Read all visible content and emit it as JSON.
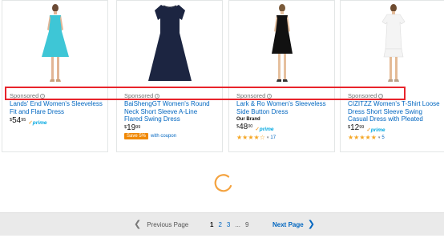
{
  "products": [
    {
      "sponsored_label": "Sponsored",
      "title_line1": "Lands' End Women's Sleeveless",
      "title_line2": "Fit and Flare Dress",
      "title_line3": "",
      "brand": "",
      "price_currency": "$",
      "price_whole": "54",
      "price_cents": "95",
      "prime_label": "prime",
      "coupon_badge": "",
      "coupon_text": "",
      "rating_stars": "",
      "rating_count": "",
      "dress_color": "#3ec6d6"
    },
    {
      "sponsored_label": "Sponsored",
      "title_line1": "BaiShengGT Women's Round",
      "title_line2": "Neck Short Sleeve A-Line",
      "title_line3": "Flared Swing Dress",
      "brand": "",
      "price_currency": "$",
      "price_whole": "19",
      "price_cents": "99",
      "prime_label": "",
      "coupon_badge": "Save 5%",
      "coupon_text": "with coupon",
      "rating_stars": "",
      "rating_count": "",
      "dress_color": "#1c2541"
    },
    {
      "sponsored_label": "Sponsored",
      "title_line1": "Lark & Ro Women's Sleeveless",
      "title_line2": "Side Button Dress",
      "title_line3": "",
      "brand": "Our Brand",
      "price_currency": "$",
      "price_whole": "48",
      "price_cents": "00",
      "prime_label": "prime",
      "coupon_badge": "",
      "coupon_text": "",
      "rating_stars": "★★★★☆",
      "rating_count": "17",
      "dress_color": "#111111"
    },
    {
      "sponsored_label": "Sponsored",
      "title_line1": "CIZITZZ Women's T-Shirt Loose",
      "title_line2": "Dress Short Sleeve Swing",
      "title_line3": "Casual Dress with Pleated",
      "brand": "",
      "price_currency": "$",
      "price_whole": "12",
      "price_cents": "99",
      "prime_label": "prime",
      "coupon_badge": "",
      "coupon_text": "",
      "rating_stars": "★★★★★",
      "rating_count": "5",
      "dress_color": "#f4f4f4"
    }
  ],
  "pagination": {
    "prev_label": "Previous Page",
    "pages": [
      "1",
      "2",
      "3"
    ],
    "ellipsis": "...",
    "last_page": "9",
    "next_label": "Next Page"
  },
  "colors": {
    "highlight": "#e8242c",
    "link": "#0066c0",
    "star": "#f5a623",
    "prime": "#00a8e1"
  }
}
